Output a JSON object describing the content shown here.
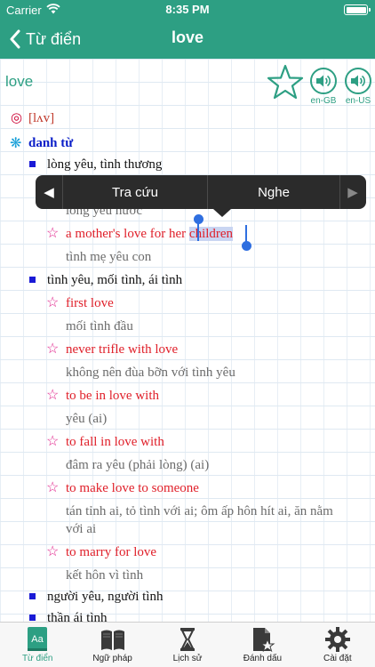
{
  "status_bar": {
    "carrier": "Carrier",
    "time": "8:35 PM"
  },
  "nav": {
    "back_label": "Từ điển",
    "title": "love"
  },
  "entry": {
    "headword": "love",
    "audio": [
      {
        "label": "en-GB"
      },
      {
        "label": "en-US"
      }
    ],
    "phonetic_icon": "◎",
    "phonetic": "[lʌv]",
    "pos_icon": "❋",
    "part_of_speech": "danh từ",
    "senses": [
      {
        "meaning": "lòng yêu, tình thương"
      },
      {
        "hidden_translation": "lòng yêu nước"
      },
      {
        "example_before": "a mother's love for her ",
        "example_selected": "children",
        "translation": "tình mẹ yêu con"
      },
      {
        "meaning": "tình yêu, mối tình, ái tình"
      },
      {
        "example": "first love",
        "translation": "mối tình đầu"
      },
      {
        "example": "never trifle with love",
        "translation": "không nên đùa bỡn với tình yêu"
      },
      {
        "example": "to be in love with",
        "translation": "yêu (ai)"
      },
      {
        "example": "to fall in love with",
        "translation": "đâm ra yêu (phải lòng) (ai)"
      },
      {
        "example": "to make love to someone",
        "translation_line1": "tán tỉnh ai, tỏ tình với ai; ôm ấp hôn hít ai, ăn nằm",
        "translation_line2": "với ai"
      },
      {
        "example": "to marry for love",
        "translation": "kết hôn vì tình"
      },
      {
        "meaning": "người yêu, người tình"
      },
      {
        "meaning": "thần ái tình"
      }
    ]
  },
  "context_menu": {
    "left_arrow": "◀",
    "right_arrow": "▶",
    "items": [
      "Tra cứu",
      "Nghe"
    ]
  },
  "tabs": [
    {
      "label": "Từ điển",
      "icon": "dictionary-icon",
      "active": true
    },
    {
      "label": "Ngữ pháp",
      "icon": "book-icon"
    },
    {
      "label": "Lịch sử",
      "icon": "hourglass-icon"
    },
    {
      "label": "Đánh dấu",
      "icon": "bookmark-document-icon"
    },
    {
      "label": "Cài đặt",
      "icon": "gear-icon"
    }
  ],
  "colors": {
    "accent": "#2d9f83",
    "example_red": "#e0202a",
    "star_pink": "#e0208a",
    "pos_blue": "#0a1ec8",
    "translation_gray": "#6b6b6b"
  }
}
